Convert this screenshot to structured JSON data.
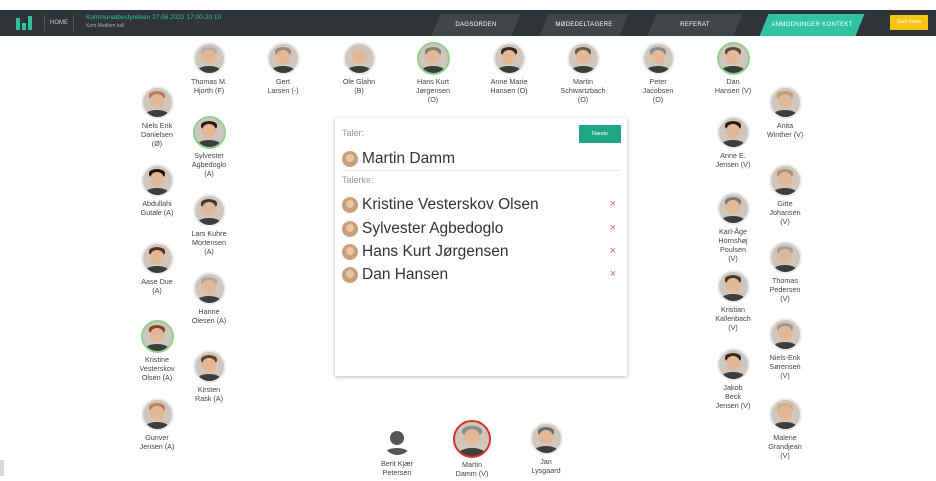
{
  "header": {
    "home_label": "HOME",
    "meeting_title": "Kommunalbestyrelsen 27.06.2022 17:00-20:10",
    "meeting_subtitle": "Kom Medlem kall",
    "tabs": [
      {
        "label": "DAGSORDEN",
        "active": false
      },
      {
        "label": "MØDEDELTAGERE",
        "active": false
      },
      {
        "label": "REFERAT",
        "active": false
      },
      {
        "label": "ANMODNINGER KONTEKT",
        "active": true
      }
    ],
    "yellow_button": "Start møde"
  },
  "colors": {
    "accent": "#2fc3a4",
    "active_speaker": "#d8302c",
    "next_button": "#1fa786",
    "warning": "#f6c40e"
  },
  "speaker_card": {
    "speaker_heading": "Taler:",
    "current_speaker": "Martin Damm",
    "queue_heading": "Talerke:",
    "next_button": "Næste",
    "queue": [
      "Kristine Vesterskov Olsen",
      "Sylvester Agbedoglo",
      "Hans Kurt Jørgensen",
      "Dan Hansen"
    ],
    "remove_glyph": "×"
  },
  "members": [
    {
      "id": "thomas-hjorth",
      "lines": [
        "Thomas M.",
        "Hjorth (F)"
      ],
      "ring": "none",
      "hair": "#b8b0a8"
    },
    {
      "id": "gert-larsen",
      "lines": [
        "Gert",
        "Larsen (-)"
      ],
      "ring": "none",
      "hair": "#9a8a7a"
    },
    {
      "id": "ole-glahn",
      "lines": [
        "Ole Glahn",
        "(B)"
      ],
      "ring": "none",
      "hair": "#c9c5c0"
    },
    {
      "id": "hans-kurt-jorgensen",
      "lines": [
        "Hans Kurt",
        "Jørgensen",
        "(O)"
      ],
      "ring": "green",
      "hair": "#8a7d70"
    },
    {
      "id": "anne-marie-hansen",
      "lines": [
        "Anne Marie",
        "Hansen (O)"
      ],
      "ring": "none",
      "hair": "#3a2a22"
    },
    {
      "id": "martin-schwartzbach",
      "lines": [
        "Martin",
        "Schwartzbach",
        "(O)"
      ],
      "ring": "none",
      "hair": "#6a5a4a"
    },
    {
      "id": "peter-jacobsen",
      "lines": [
        "Peter",
        "Jacobsen",
        "(O)"
      ],
      "ring": "none",
      "hair": "#8a8a8a"
    },
    {
      "id": "dan-hansen",
      "lines": [
        "Dan",
        "Hansen (V)"
      ],
      "ring": "green",
      "hair": "#5a4a3a"
    },
    {
      "id": "niels-erik-danielsen",
      "lines": [
        "Niels Erik",
        "Danielsen",
        "(Ø)"
      ],
      "ring": "none",
      "hair": "#c07a5a"
    },
    {
      "id": "sylvester-agbedoglo",
      "lines": [
        "Sylvester",
        "Agbedoglo",
        "(A)"
      ],
      "ring": "green",
      "hair": "#2a1a10"
    },
    {
      "id": "abdullahi-gutale",
      "lines": [
        "Abdullahi",
        "Gutale (A)"
      ],
      "ring": "none",
      "hair": "#1a1008"
    },
    {
      "id": "lars-kuhre-mortensen",
      "lines": [
        "Lars Kuhre",
        "Mortensen",
        "(A)"
      ],
      "ring": "none",
      "hair": "#3a3a3a"
    },
    {
      "id": "aase-due",
      "lines": [
        "Aase Due",
        "(A)"
      ],
      "ring": "none",
      "hair": "#5a3020"
    },
    {
      "id": "hanne-olesen",
      "lines": [
        "Hanne",
        "Olesen (A)"
      ],
      "ring": "none",
      "hair": "#b0a8a0"
    },
    {
      "id": "kristine-vesterskov-olsen",
      "lines": [
        "Kristine",
        "Vesterskov",
        "Olsen (A)"
      ],
      "ring": "green",
      "hair": "#7a4a2a"
    },
    {
      "id": "kirsten-rask",
      "lines": [
        "Kirsten",
        "Rask (A)"
      ],
      "ring": "none",
      "hair": "#6a4030"
    },
    {
      "id": "gunver-jensen",
      "lines": [
        "Gunver",
        "Jensen (A)"
      ],
      "ring": "none",
      "hair": "#c08060"
    },
    {
      "id": "anita-winther",
      "lines": [
        "Anita",
        "Winther (V)"
      ],
      "ring": "none",
      "hair": "#c0a070"
    },
    {
      "id": "anne-e-jensen",
      "lines": [
        "Anne E.",
        "Jensen (V)"
      ],
      "ring": "none",
      "hair": "#2a1a10"
    },
    {
      "id": "gitte-johansen",
      "lines": [
        "Gitte",
        "Johansen",
        "(V)"
      ],
      "ring": "none",
      "hair": "#b09070"
    },
    {
      "id": "karl-age-hornshoj-poulsen",
      "lines": [
        "Karl-Åge",
        "Hornshøj",
        "Poulsen",
        "(V)"
      ],
      "ring": "none",
      "hair": "#7a7a7a"
    },
    {
      "id": "thomas-pedersen",
      "lines": [
        "Thomas",
        "Pedersen",
        "(V)"
      ],
      "ring": "none",
      "hair": "#a0a0a0"
    },
    {
      "id": "kristian-kallenbach",
      "lines": [
        "Kristian",
        "Kallenbach",
        "(V)"
      ],
      "ring": "none",
      "hair": "#4a3a2a"
    },
    {
      "id": "niels-erik-sorensen",
      "lines": [
        "Niels-Erik",
        "Sørensen",
        "(V)"
      ],
      "ring": "none",
      "hair": "#9a9a9a"
    },
    {
      "id": "jakob-beck-jensen",
      "lines": [
        "Jakob",
        "Beck",
        "Jensen (V)"
      ],
      "ring": "none",
      "hair": "#3a2a1a"
    },
    {
      "id": "malene-grandjean",
      "lines": [
        "Malene",
        "Grandjean",
        "(V)"
      ],
      "ring": "none",
      "hair": "#d0b080"
    },
    {
      "id": "berit-kjaer-petersen",
      "lines": [
        "Berit Kjær",
        "Petersen"
      ],
      "ring": "none",
      "silhouette": true
    },
    {
      "id": "martin-damm",
      "lines": [
        "Martin",
        "Damm (V)"
      ],
      "ring": "red",
      "hair": "#8a8a8a"
    },
    {
      "id": "jan-lysgaard",
      "lines": [
        "Jan",
        "Lysgaard"
      ],
      "ring": "none",
      "hair": "#6a6a6a"
    }
  ]
}
